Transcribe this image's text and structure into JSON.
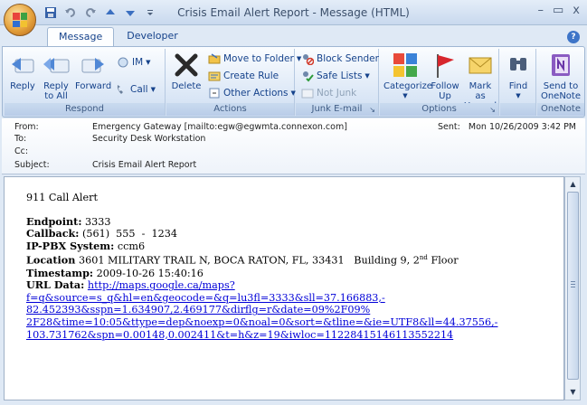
{
  "window": {
    "title": "Crisis Email Alert Report - Message (HTML)",
    "minimize": "–",
    "maximize": "▭",
    "close": "x"
  },
  "tabs": [
    "Message",
    "Developer"
  ],
  "help": "?",
  "ribbon": {
    "respond": {
      "label": "Respond",
      "reply": "Reply",
      "reply_all": "Reply\nto All",
      "forward": "Forward",
      "im": "IM",
      "call": "Call"
    },
    "actions": {
      "label": "Actions",
      "delete": "Delete",
      "move_to_folder": "Move to Folder",
      "create_rule": "Create Rule",
      "other_actions": "Other Actions"
    },
    "junk": {
      "label": "Junk E-mail",
      "block_sender": "Block Sender",
      "safe_lists": "Safe Lists",
      "not_junk": "Not Junk"
    },
    "options": {
      "label": "Options",
      "categorize": "Categorize",
      "follow_up": "Follow\nUp",
      "mark_unread": "Mark as\nUnread"
    },
    "find": {
      "label": "",
      "find": "Find"
    },
    "onenote": {
      "label": "OneNote",
      "send": "Send to\nOneNote"
    }
  },
  "header": {
    "from_label": "From:",
    "from_value": "Emergency Gateway [mailto:egw@egwmta.connexon.com]",
    "to_label": "To:",
    "to_value": "Security Desk Workstation",
    "cc_label": "Cc:",
    "cc_value": "",
    "subject_label": "Subject:",
    "subject_value": "Crisis Email Alert Report",
    "sent_label": "Sent:",
    "sent_value": "Mon 10/26/2009 3:42 PM"
  },
  "message": {
    "heading": "911 Call Alert",
    "endpoint_label": "Endpoint:",
    "endpoint_value": "3333",
    "callback_label": "Callback:",
    "callback_value": "(561)  555  -  1234",
    "system_label": "IP-PBX System:",
    "system_value": "ccm6",
    "location_label": "Location",
    "location_value": "3601 MILITARY TRAIL N, BOCA RATON, FL, 33431   Building 9, 2",
    "location_sup": "nd",
    "location_floor": " Floor",
    "timestamp_label": "Timestamp:",
    "timestamp_value": "2009-10-26 15:40:16",
    "url_label": "URL Data:",
    "url_line1": "http://maps.google.ca/maps?",
    "url_line2": "f=q&source=s_q&hl=en&geocode=&q=lu3fl=3333&sll=37.166883,-",
    "url_line3": "82.452393&sspn=1.634907,2.469177&dirflg=r&date=09%2F09%",
    "url_line4": "2F28&time=10:05&ttype=dep&noexp=0&noal=0&sort=&tline=&ie=UTF8&ll=44.37556,-",
    "url_line5": "103.731762&spn=0.00148,0.002411&t=h&z=19&iwloc=11228415146113552214"
  }
}
